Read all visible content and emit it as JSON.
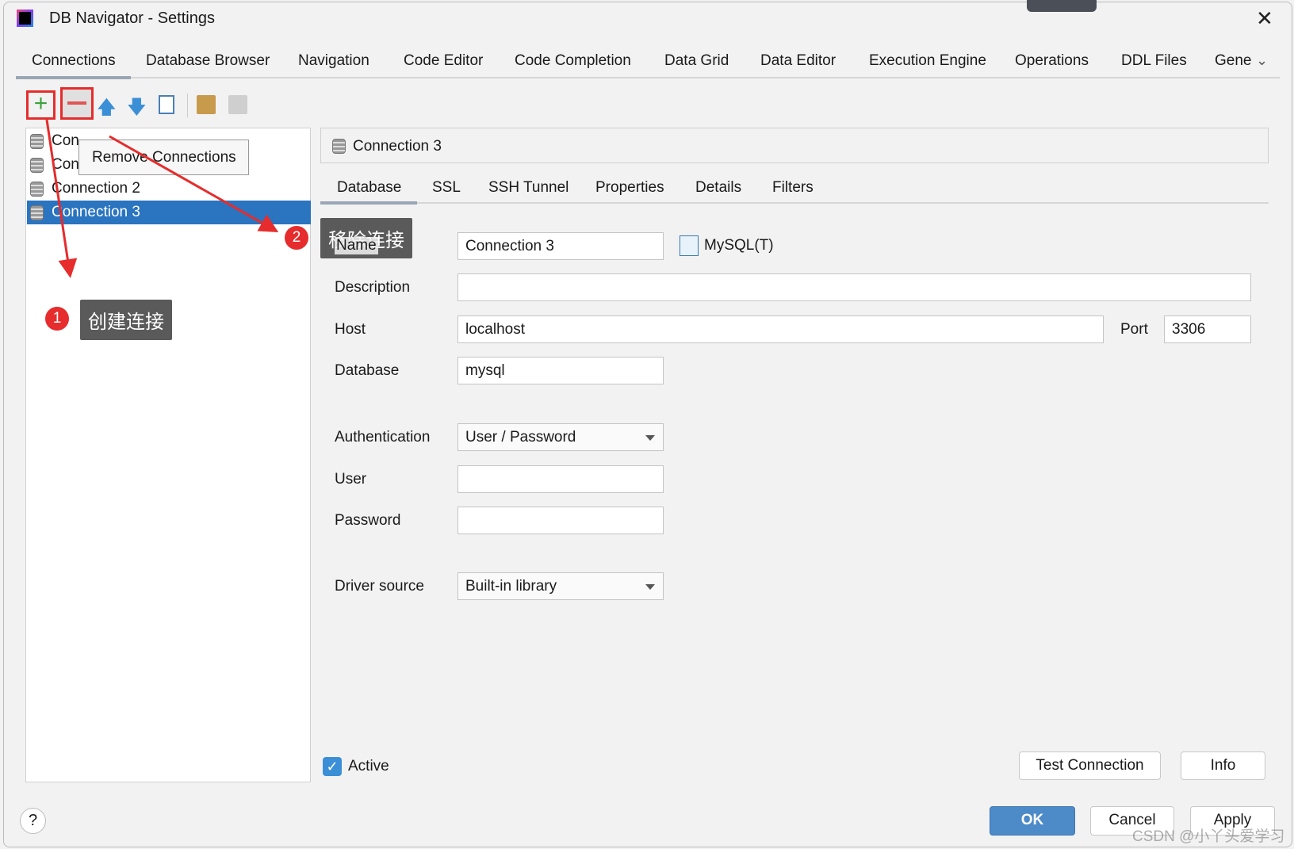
{
  "window": {
    "title": "DB Navigator - Settings",
    "close_icon": "close-icon",
    "app_icon": "intellij-icon"
  },
  "tabs": [
    "Connections",
    "Database Browser",
    "Navigation",
    "Code Editor",
    "Code Completion",
    "Data Grid",
    "Data Editor",
    "Execution Engine",
    "Operations",
    "DDL Files",
    "Gene"
  ],
  "active_tab": "Connections",
  "toolbar": {
    "icons": [
      "add-icon",
      "remove-icon",
      "move-up-icon",
      "move-down-icon",
      "copy-icon",
      "paste-icon",
      "paste-disabled-icon"
    ],
    "tooltip": "Remove Connections"
  },
  "tree": {
    "items": [
      "Connection 1",
      "Connection 1",
      "Connection 2",
      "Connection 3"
    ],
    "visible_items": [
      "Con",
      "Con",
      "Connection 2",
      "Connection 3"
    ],
    "selected": "Connection 3"
  },
  "detail": {
    "header": "Connection 3",
    "subtabs": [
      "Database",
      "SSL",
      "SSH Tunnel",
      "Properties",
      "Details",
      "Filters"
    ],
    "active_subtab": "Database"
  },
  "form": {
    "name_label": "Name",
    "name_value": "Connection 3",
    "db_type": "MySQL(T)",
    "description_label": "Description",
    "description_value": "",
    "host_label": "Host",
    "host_value": "localhost",
    "port_label": "Port",
    "port_value": "3306",
    "database_label": "Database",
    "database_value": "mysql",
    "auth_label": "Authentication",
    "auth_value": "User / Password",
    "user_label": "User",
    "user_value": "",
    "password_label": "Password",
    "password_value": "",
    "driver_label": "Driver source",
    "driver_value": "Built-in library",
    "active_label": "Active",
    "active_checked": true,
    "test_button": "Test Connection",
    "info_button": "Info"
  },
  "footer": {
    "help": "?",
    "ok": "OK",
    "cancel": "Cancel",
    "apply": "Apply"
  },
  "annotations": {
    "badge1": "1",
    "callout1": "创建连接",
    "badge2": "2",
    "callout2": "移除连接",
    "color": "#e62c2c"
  },
  "watermark": "CSDN @小丫头爱学习",
  "colors": {
    "selection": "#2a74c0",
    "ok_button": "#4d8ac8",
    "tab_underline": "#9aa6b5"
  }
}
